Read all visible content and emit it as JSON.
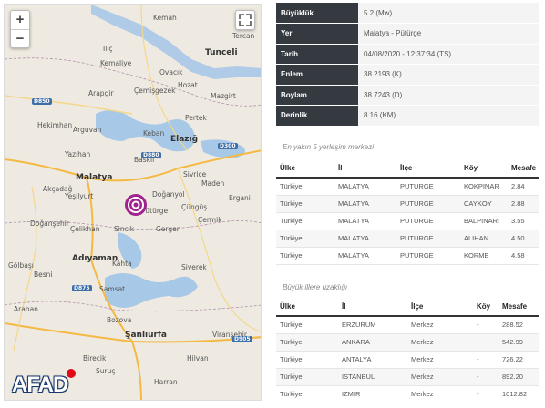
{
  "map": {
    "zoom_in": "+",
    "zoom_out": "−",
    "logo_text": "AFAD",
    "cities": [
      "Kemah",
      "Tercan",
      "Ilıç",
      "Kemaliye",
      "Tunceli",
      "Hozat",
      "Ovacık",
      "Mazgirt",
      "Arapgir",
      "Çemişgezek",
      "Pertek",
      "Hekimhan",
      "Arguvan",
      "Keban",
      "Elazığ",
      "Yazıhan",
      "Baskil",
      "Sivrice",
      "Malatya",
      "Akçadağ",
      "Yeşilyurt",
      "Doğanyol",
      "Maden",
      "Ergani",
      "Pütürge",
      "Çüngüş",
      "Doğanşehir",
      "Çermik",
      "Çelikhan",
      "Sincik",
      "Gerger",
      "Adıyaman",
      "Kâhta",
      "Gölbaşı",
      "Besni",
      "Siverek",
      "Samsat",
      "Araban",
      "Bozova",
      "Şanlıurfa",
      "Viranşehir",
      "Birecik",
      "Suruç",
      "Harran",
      "Hilvan"
    ],
    "roads": [
      "D850",
      "D880",
      "D300",
      "D875",
      "D905"
    ]
  },
  "info": {
    "rows": [
      {
        "key": "Büyüklük",
        "value": "5.2 (Mw)"
      },
      {
        "key": "Yer",
        "value": "Malatya - Pütürge"
      },
      {
        "key": "Tarih",
        "value": "04/08/2020 - 12:37:34 (TS)"
      },
      {
        "key": "Enlem",
        "value": "38.2193 (K)"
      },
      {
        "key": "Boylam",
        "value": "38.7243 (D)"
      },
      {
        "key": "Derinlik",
        "value": "8.16 (KM)"
      }
    ]
  },
  "nearest": {
    "title": "En yakın 5 yerleşim merkezi",
    "headers": [
      "Ülke",
      "İl",
      "İlçe",
      "Köy",
      "Mesafe"
    ],
    "rows": [
      [
        "Türkiye",
        "MALATYA",
        "PUTURGE",
        "KOKPINAR",
        "2.84"
      ],
      [
        "Türkiye",
        "MALATYA",
        "PUTURGE",
        "CAYKOY",
        "2.88"
      ],
      [
        "Türkiye",
        "MALATYA",
        "PUTURGE",
        "BALPINARI",
        "3.55"
      ],
      [
        "Türkiye",
        "MALATYA",
        "PUTURGE",
        "ALIHAN",
        "4.50"
      ],
      [
        "Türkiye",
        "MALATYA",
        "PUTURGE",
        "KORME",
        "4.58"
      ]
    ]
  },
  "distances": {
    "title": "Büyük illere uzaklığı",
    "headers": [
      "Ülke",
      "İl",
      "İlçe",
      "Köy",
      "Mesafe"
    ],
    "rows": [
      [
        "Türkiye",
        "ERZURUM",
        "Merkez",
        "-",
        "288.52"
      ],
      [
        "Türkiye",
        "ANKARA",
        "Merkez",
        "-",
        "542.99"
      ],
      [
        "Türkiye",
        "ANTALYA",
        "Merkez",
        "-",
        "726.22"
      ],
      [
        "Türkiye",
        "ISTANBUL",
        "Merkez",
        "-",
        "892.20"
      ],
      [
        "Türkiye",
        "IZMIR",
        "Merkez",
        "-",
        "1012.82"
      ]
    ]
  }
}
